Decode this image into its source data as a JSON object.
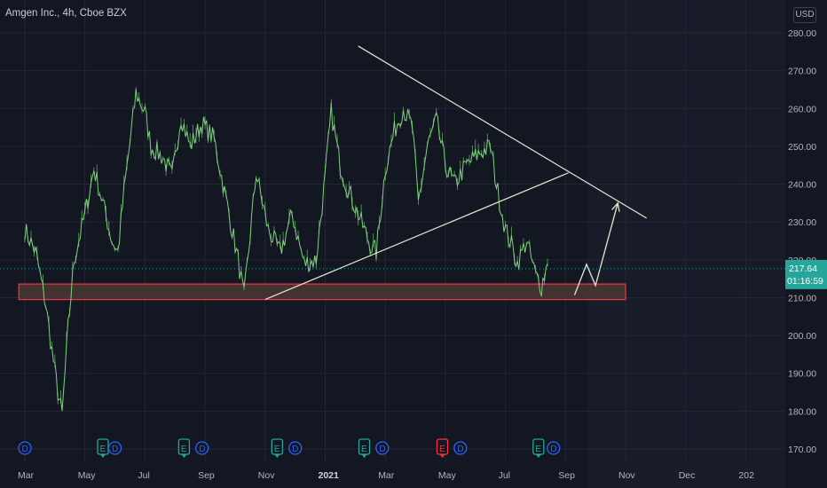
{
  "header": {
    "title": "Amgen Inc., 4h, Cboe BZX",
    "currency": "USD"
  },
  "chart_data": {
    "type": "line",
    "symbol": "Amgen Inc.",
    "interval": "4h",
    "exchange": "Cboe BZX",
    "ylim": [
      167,
      284
    ],
    "y_ticks": [
      170,
      180,
      190,
      200,
      210,
      220,
      230,
      240,
      250,
      260,
      270,
      280
    ],
    "y_tick_labels": [
      "170.00",
      "180.00",
      "190.00",
      "200.00",
      "210.00",
      "220.00",
      "230.00",
      "240.00",
      "250.00",
      "260.00",
      "270.00",
      "280.00"
    ],
    "x_tick_labels": [
      "Mar",
      "May",
      "Jul",
      "Sep",
      "Nov",
      "2021",
      "Mar",
      "May",
      "Jul",
      "Sep",
      "Nov",
      "Dec",
      "202"
    ],
    "price_anchors": [
      [
        0,
        228
      ],
      [
        0.18,
        222
      ],
      [
        0.35,
        208
      ],
      [
        0.45,
        196
      ],
      [
        0.55,
        185
      ],
      [
        0.62,
        179
      ],
      [
        0.72,
        202
      ],
      [
        0.82,
        220
      ],
      [
        1.0,
        232
      ],
      [
        1.15,
        244
      ],
      [
        1.3,
        235
      ],
      [
        1.45,
        225
      ],
      [
        1.55,
        222
      ],
      [
        1.65,
        238
      ],
      [
        1.85,
        264
      ],
      [
        2.0,
        259
      ],
      [
        2.1,
        250
      ],
      [
        2.3,
        247
      ],
      [
        2.45,
        242
      ],
      [
        2.6,
        258
      ],
      [
        2.75,
        250
      ],
      [
        2.95,
        256
      ],
      [
        3.15,
        252
      ],
      [
        3.35,
        236
      ],
      [
        3.55,
        220
      ],
      [
        3.65,
        210
      ],
      [
        3.85,
        243
      ],
      [
        4.05,
        228
      ],
      [
        4.25,
        222
      ],
      [
        4.45,
        232
      ],
      [
        4.65,
        219
      ],
      [
        4.85,
        220
      ],
      [
        5.0,
        242
      ],
      [
        5.1,
        259
      ],
      [
        5.25,
        245
      ],
      [
        5.35,
        240
      ],
      [
        5.55,
        232
      ],
      [
        5.75,
        224
      ],
      [
        5.85,
        222
      ],
      [
        6.0,
        244
      ],
      [
        6.15,
        254
      ],
      [
        6.3,
        260
      ],
      [
        6.45,
        255
      ],
      [
        6.55,
        235
      ],
      [
        6.7,
        250
      ],
      [
        6.85,
        257
      ],
      [
        7.0,
        245
      ],
      [
        7.15,
        240
      ],
      [
        7.35,
        245
      ],
      [
        7.55,
        248
      ],
      [
        7.75,
        250
      ],
      [
        7.85,
        240
      ],
      [
        8.0,
        228
      ],
      [
        8.1,
        224
      ],
      [
        8.2,
        219
      ],
      [
        8.35,
        225
      ],
      [
        8.5,
        216
      ],
      [
        8.6,
        213
      ],
      [
        8.7,
        219
      ]
    ],
    "trendlines": [
      {
        "name": "descending-resistance",
        "from": [
          5.55,
          276.5
        ],
        "to": [
          10.35,
          231
        ]
      },
      {
        "name": "ascending-support",
        "from": [
          4.0,
          209.5
        ],
        "to": [
          9.05,
          243
        ]
      }
    ],
    "support_zone": {
      "low": 209.5,
      "high": 213.6,
      "from": -0.1,
      "to": 10.0
    },
    "projection": [
      [
        9.15,
        210.7
      ],
      [
        9.35,
        218.8
      ],
      [
        9.5,
        213.2
      ],
      [
        9.87,
        235
      ]
    ],
    "last_price": 217.64,
    "last_price_label": "217.64",
    "countdown_label": "01:16:59",
    "earnings_markers": [
      {
        "x": 0.0,
        "letter": "D",
        "kind": "dividend"
      },
      {
        "x": 1.3,
        "letter": "E",
        "kind": "earnings"
      },
      {
        "x": 1.5,
        "letter": "D",
        "kind": "dividend"
      },
      {
        "x": 2.65,
        "letter": "E",
        "kind": "earnings"
      },
      {
        "x": 2.95,
        "letter": "D",
        "kind": "dividend"
      },
      {
        "x": 4.2,
        "letter": "E",
        "kind": "earnings"
      },
      {
        "x": 4.5,
        "letter": "D",
        "kind": "dividend"
      },
      {
        "x": 5.65,
        "letter": "E",
        "kind": "earnings"
      },
      {
        "x": 5.95,
        "letter": "D",
        "kind": "dividend"
      },
      {
        "x": 6.95,
        "letter": "E",
        "kind": "earnings-negative"
      },
      {
        "x": 7.25,
        "letter": "D",
        "kind": "dividend"
      },
      {
        "x": 8.55,
        "letter": "E",
        "kind": "earnings"
      },
      {
        "x": 8.8,
        "letter": "D",
        "kind": "dividend"
      }
    ],
    "grid": true
  },
  "colors": {
    "background": "#131722",
    "future_background": "#181c28",
    "grid": "#232734",
    "price_line": "#7fd17e",
    "trendline": "#e8e6cf",
    "zone_fill": "#4a3833",
    "zone_border": "#f23645",
    "axis_text": "#b2b5be",
    "last_price_bg": "#26a69a",
    "earnings": "#26a69a",
    "earnings_negative": "#f23645",
    "dividend": "#2962ff"
  }
}
